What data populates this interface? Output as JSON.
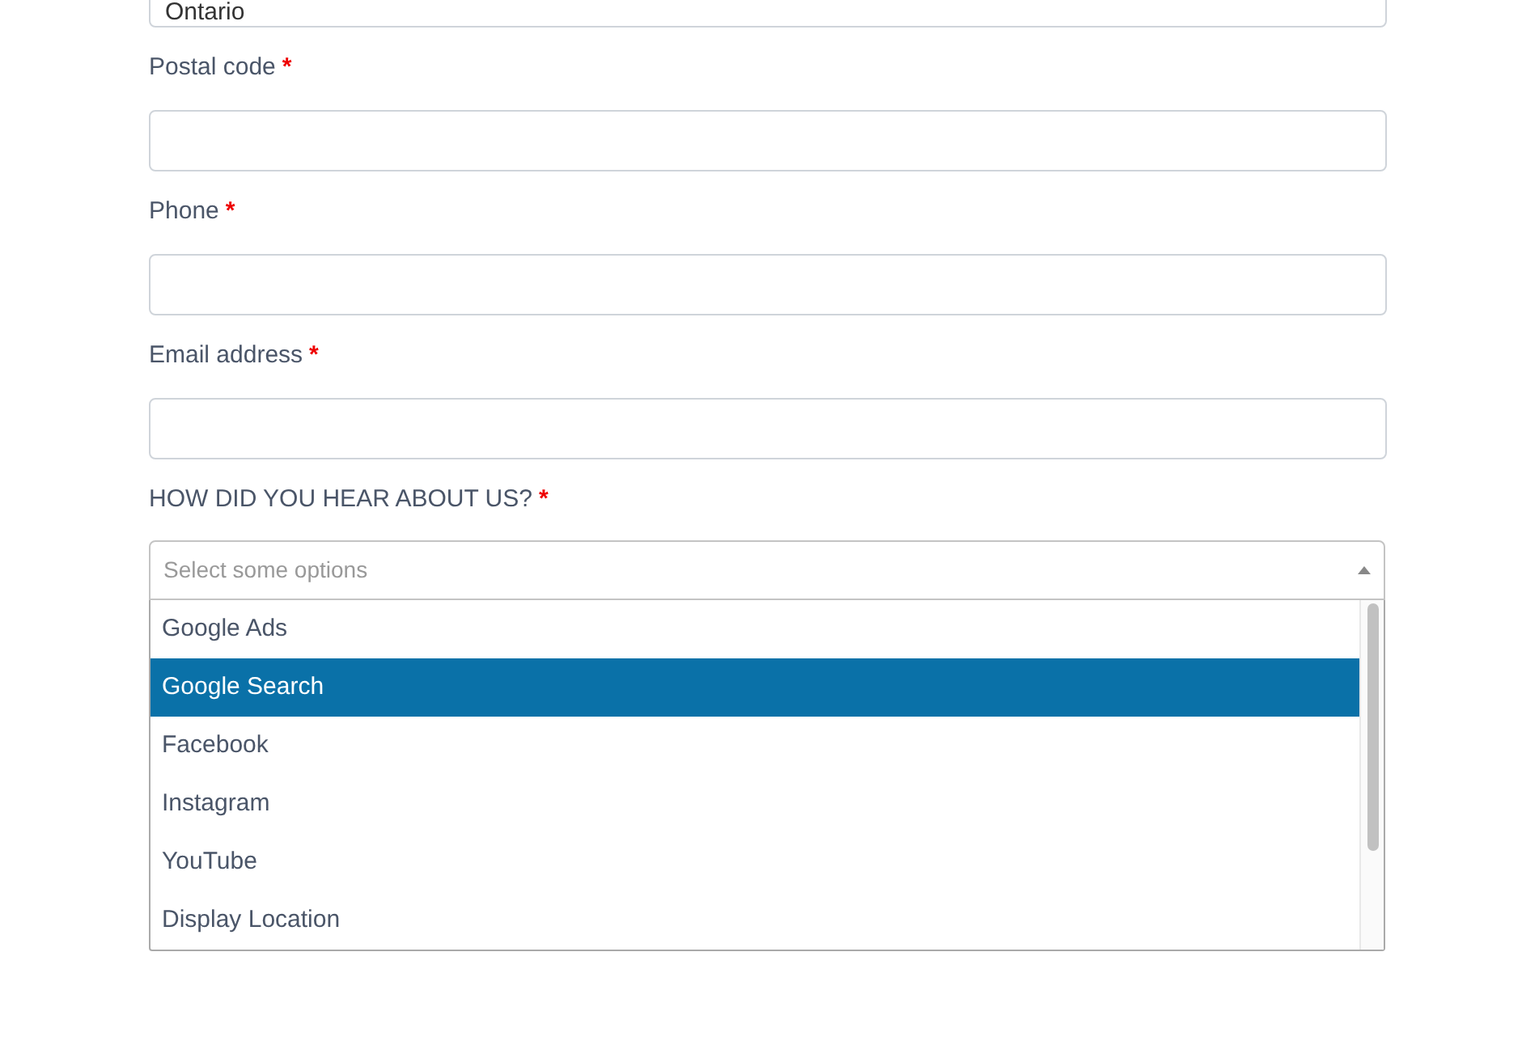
{
  "province_field": {
    "value": "Ontario"
  },
  "fields": [
    {
      "label": "Postal code",
      "required_mark": "*"
    },
    {
      "label": "Phone",
      "required_mark": "*"
    },
    {
      "label": "Email address",
      "required_mark": "*"
    }
  ],
  "referral": {
    "label": "HOW DID YOU HEAR ABOUT US?",
    "required_mark": "*",
    "placeholder": "Select some options",
    "expanded": true,
    "options": [
      {
        "label": "Google Ads",
        "selected": false
      },
      {
        "label": "Google Search",
        "selected": true
      },
      {
        "label": "Facebook",
        "selected": false
      },
      {
        "label": "Instagram",
        "selected": false
      },
      {
        "label": "YouTube",
        "selected": false
      },
      {
        "label": "Display Location",
        "selected": false
      }
    ]
  }
}
